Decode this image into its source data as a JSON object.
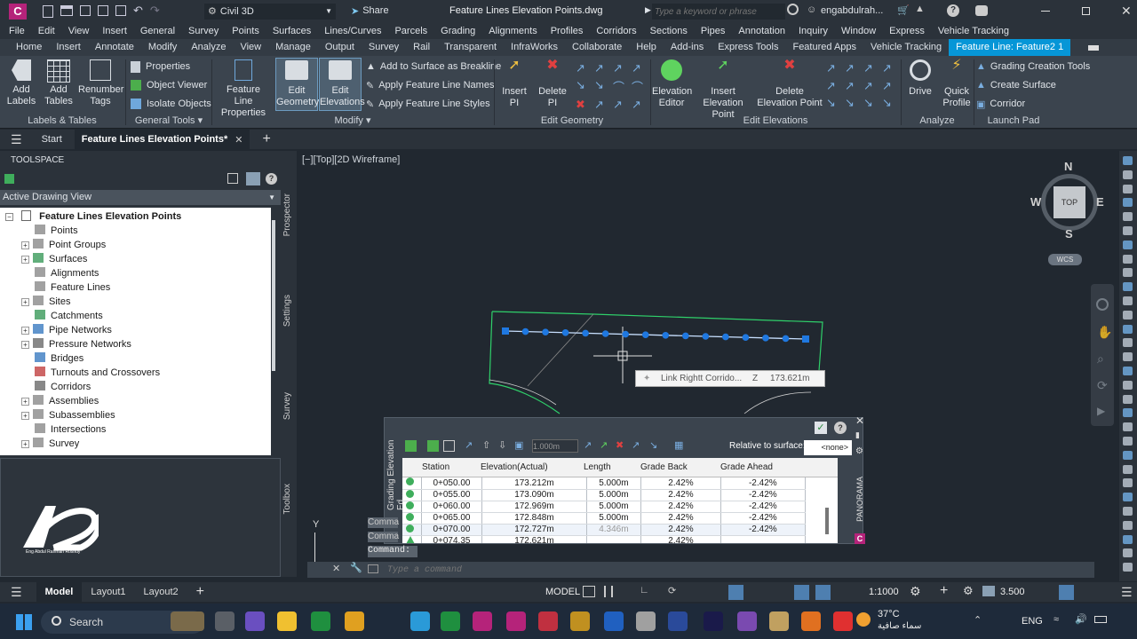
{
  "title_bar": {
    "workspace": "Civil 3D",
    "share": "Share",
    "document": "Feature Lines Elevation Points.dwg",
    "search_placeholder": "Type a keyword or phrase",
    "user": "engabdulrah..."
  },
  "menu": [
    "File",
    "Edit",
    "View",
    "Insert",
    "General",
    "Survey",
    "Points",
    "Surfaces",
    "Lines/Curves",
    "Parcels",
    "Grading",
    "Alignments",
    "Profiles",
    "Corridors",
    "Sections",
    "Pipes",
    "Annotation",
    "Inquiry",
    "Window",
    "Express",
    "Vehicle Tracking"
  ],
  "ribbon_tabs": [
    "Home",
    "Insert",
    "Annotate",
    "Modify",
    "Analyze",
    "View",
    "Manage",
    "Output",
    "Survey",
    "Rail",
    "Transparent",
    "InfraWorks",
    "Collaborate",
    "Help",
    "Add-ins",
    "Express Tools",
    "Featured Apps",
    "Vehicle Tracking",
    "Feature Line: Feature2 1"
  ],
  "ribbon": {
    "labels_tables": {
      "title": "Labels & Tables",
      "add_labels": "Add Labels",
      "add_tables": "Add Tables",
      "renumber_tags": "Renumber Tags"
    },
    "general_tools": {
      "title": "General Tools",
      "properties": "Properties",
      "object_viewer": "Object Viewer",
      "isolate_objects": "Isolate Objects"
    },
    "modify": {
      "title": "Modify",
      "feature_line_properties": "Feature Line Properties",
      "edit_geometry": "Edit Geometry",
      "edit_elevations": "Edit Elevations",
      "add_to_surface": "Add to Surface as Breakline",
      "apply_names": "Apply Feature Line Names",
      "apply_styles": "Apply Feature Line Styles"
    },
    "edit_geometry": {
      "title": "Edit Geometry",
      "insert_pi": "Insert PI",
      "delete_pi": "Delete PI"
    },
    "edit_elevations": {
      "title": "Edit Elevations",
      "elevation_editor": "Elevation Editor",
      "insert_elevation_point": "Insert Elevation Point",
      "delete_elevation_point": "Delete Elevation Point"
    },
    "analyze": {
      "title": "Analyze",
      "drive": "Drive",
      "quick_profile": "Quick Profile"
    },
    "launch_pad": {
      "title": "Launch Pad",
      "grading_creation_tools": "Grading Creation Tools",
      "create_surface": "Create Surface",
      "corridor": "Corridor"
    }
  },
  "doc_tabs": {
    "start": "Start",
    "active": "Feature Lines Elevation Points*"
  },
  "toolspace": {
    "title": "TOOLSPACE",
    "view": "Active Drawing View",
    "root": "Feature Lines Elevation Points",
    "items": [
      "Points",
      "Point Groups",
      "Surfaces",
      "Alignments",
      "Feature Lines",
      "Sites",
      "Catchments",
      "Pipe Networks",
      "Pressure Networks",
      "Bridges",
      "Turnouts and Crossovers",
      "Corridors",
      "Assemblies",
      "Subassemblies",
      "Intersections",
      "Survey"
    ],
    "side_tabs": [
      "Prospector",
      "Settings",
      "Survey",
      "Toolbox"
    ],
    "logo_caption": "Eng Abdul Rahman Roshdy"
  },
  "viewport": {
    "label": "[−][Top][2D Wireframe]",
    "compass": {
      "n": "N",
      "s": "S",
      "e": "E",
      "w": "W",
      "top": "TOP",
      "wcs": "WCS"
    },
    "tooltip_name": "Link Rightt Corrido...",
    "tooltip_axis": "Z",
    "tooltip_value": "173.621m",
    "ucs_y": "Y"
  },
  "elevation_editor": {
    "title": "Grading Elevation Ed...",
    "step": "1.000m",
    "relative_label": "Relative to surface:",
    "relative_value": "<none>",
    "side_label": "PANORAMA",
    "columns": [
      "Station",
      "Elevation(Actual)",
      "Length",
      "Grade Back",
      "Grade Ahead"
    ],
    "rows": [
      [
        "0+050.00",
        "173.212m",
        "5.000m",
        "2.42%",
        "-2.42%"
      ],
      [
        "0+055.00",
        "173.090m",
        "5.000m",
        "2.42%",
        "-2.42%"
      ],
      [
        "0+060.00",
        "172.969m",
        "5.000m",
        "2.42%",
        "-2.42%"
      ],
      [
        "0+065.00",
        "172.848m",
        "5.000m",
        "2.42%",
        "-2.42%"
      ],
      [
        "0+070.00",
        "172.727m",
        "4.346m",
        "2.42%",
        "-2.42%"
      ],
      [
        "0+074.35",
        "172.621m",
        "",
        "2.42%",
        ""
      ]
    ]
  },
  "command": {
    "history1": "Comma",
    "history2": "Comma",
    "prompt": "Command:",
    "placeholder": "Type a command"
  },
  "layouts": [
    "Model",
    "Layout1",
    "Layout2"
  ],
  "status": {
    "model": "MODEL",
    "scale": "1:1000",
    "value": "3.500"
  },
  "taskbar": {
    "search": "Search",
    "temp": "37°C",
    "weather": "سماء صافية",
    "lang": "ENG"
  }
}
